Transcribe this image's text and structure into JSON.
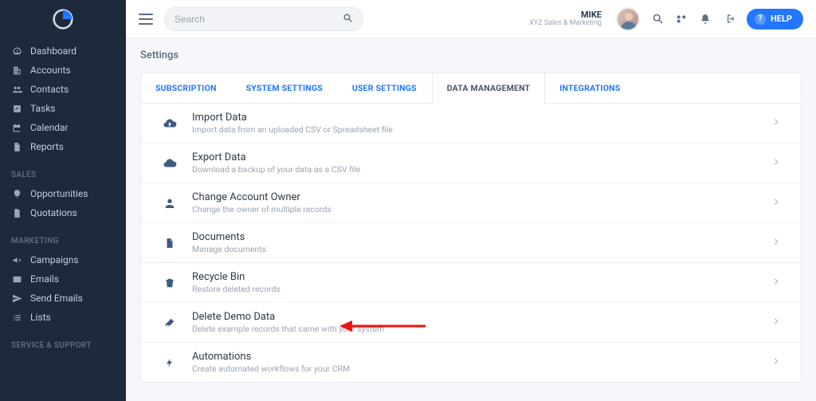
{
  "search": {
    "placeholder": "Search"
  },
  "user": {
    "name": "MIKE",
    "org": "XYZ Sales & Marketing"
  },
  "help": {
    "label": "HELP"
  },
  "page": {
    "title": "Settings"
  },
  "sidebar": {
    "main": [
      {
        "label": "Dashboard"
      },
      {
        "label": "Accounts"
      },
      {
        "label": "Contacts"
      },
      {
        "label": "Tasks"
      },
      {
        "label": "Calendar"
      },
      {
        "label": "Reports"
      }
    ],
    "groups": [
      {
        "heading": "SALES",
        "items": [
          {
            "label": "Opportunities"
          },
          {
            "label": "Quotations"
          }
        ]
      },
      {
        "heading": "MARKETING",
        "items": [
          {
            "label": "Campaigns"
          },
          {
            "label": "Emails"
          },
          {
            "label": "Send Emails"
          },
          {
            "label": "Lists"
          }
        ]
      },
      {
        "heading": "SERVICE & SUPPORT",
        "items": []
      }
    ]
  },
  "tabs": [
    {
      "label": "SUBSCRIPTION"
    },
    {
      "label": "SYSTEM SETTINGS"
    },
    {
      "label": "USER SETTINGS"
    },
    {
      "label": "DATA MANAGEMENT",
      "active": true
    },
    {
      "label": "INTEGRATIONS"
    }
  ],
  "rows": [
    {
      "title": "Import Data",
      "desc": "Import data from an uploaded CSV or Spreadsheet file"
    },
    {
      "title": "Export Data",
      "desc": "Download a backup of your data as a CSV file"
    },
    {
      "title": "Change Account Owner",
      "desc": "Change the owner of multiple records"
    },
    {
      "title": "Documents",
      "desc": "Manage documents"
    },
    {
      "title": "Recycle Bin",
      "desc": "Restore deleted records"
    },
    {
      "title": "Delete Demo Data",
      "desc": "Delete example records that came with your system"
    },
    {
      "title": "Automations",
      "desc": "Create automated workflows for your CRM"
    }
  ]
}
